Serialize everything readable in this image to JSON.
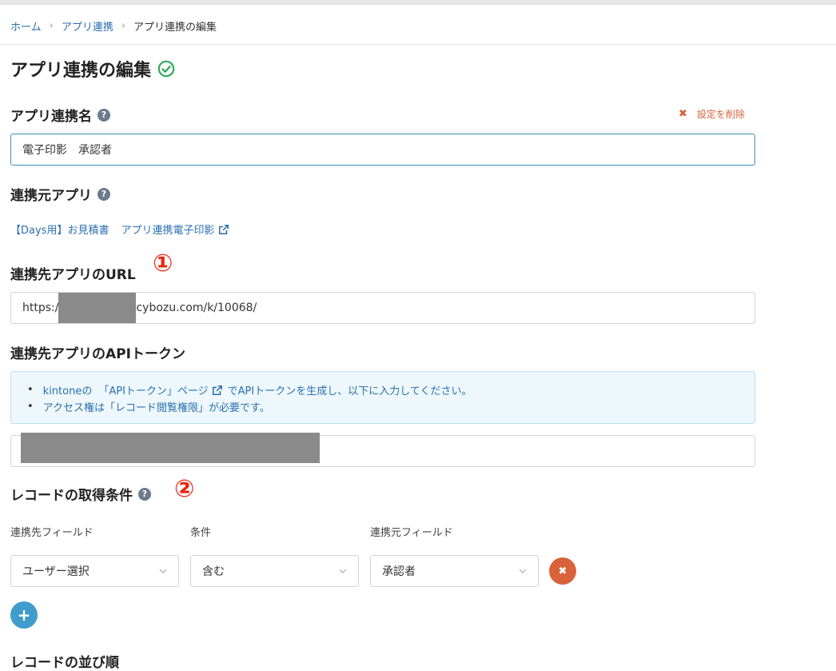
{
  "breadcrumb": {
    "home": "ホーム",
    "app_link": "アプリ連携",
    "current": "アプリ連携の編集",
    "separator": "›"
  },
  "page_title": "アプリ連携の編集",
  "sections": {
    "link_name": {
      "heading": "アプリ連携名",
      "value": "電子印影　承認者"
    },
    "delete_setting": {
      "icon": "✖",
      "label": "設定を削除"
    },
    "source_app": {
      "heading": "連携元アプリ",
      "link1": "【Days用】お見積書",
      "link2": "アプリ連携電子印影"
    },
    "target_url": {
      "heading": "連携先アプリのURL",
      "annotation": "①",
      "value_prefix": "https:/",
      "value_suffix": "cybozu.com/k/10068/"
    },
    "api_token": {
      "heading": "連携先アプリのAPIトークン",
      "info_line1_a": "kintoneの",
      "info_line1_link": "「APIトークン」ページ",
      "info_line1_b": "でAPIトークンを生成し、以下に入力してください。",
      "info_line2": "アクセス権は「レコード閲覧権限」が必要です。",
      "bullet": "•"
    },
    "conditions": {
      "heading": "レコードの取得条件",
      "annotation": "②",
      "columns": [
        "連携先フィールド",
        "条件",
        "連携元フィールド"
      ],
      "row": {
        "target_field": "ユーザー選択",
        "operator": "含む",
        "source_field": "承認者"
      },
      "remove_icon": "✖",
      "add_icon": "+"
    },
    "sort": {
      "heading": "レコードの並び順"
    }
  },
  "help_icon": "?",
  "colors": {
    "link": "#2a6fb0",
    "danger": "#d9623b",
    "accent": "#3f9ccb",
    "success": "#2eaa5c",
    "annotation": "#e8260e"
  }
}
